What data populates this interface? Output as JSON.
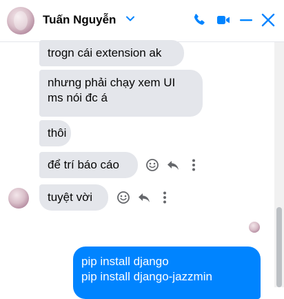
{
  "header": {
    "contact_name": "Tuấn Nguyễn",
    "icons": [
      "chevron-down-icon",
      "phone-icon",
      "video-icon",
      "minimize-icon",
      "close-icon"
    ],
    "accent_color": "#0084ff"
  },
  "messages": [
    {
      "sender": "them",
      "text": "trogn cái extension ak"
    },
    {
      "sender": "them",
      "lines": [
        "nhưng phải chạy xem UI",
        "ms nói đc á"
      ]
    },
    {
      "sender": "them",
      "text": "thôi"
    },
    {
      "sender": "them",
      "text": "để trí báo cáo"
    },
    {
      "sender": "them",
      "text": "tuyệt vời"
    },
    {
      "sender": "me",
      "lines": [
        "pip install django",
        "pip install django-jazzmin"
      ]
    }
  ],
  "message_actions": [
    "react-icon",
    "reply-icon",
    "more-icon"
  ],
  "colors": {
    "incoming_bubble": "#e4e6eb",
    "outgoing_bubble": "#0084ff"
  }
}
